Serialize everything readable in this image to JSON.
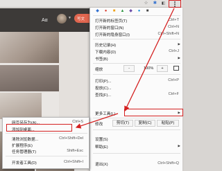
{
  "browser": {
    "avatar_text": "Aα",
    "publish_button": "写文",
    "toolbar_icons": [
      "star-icon",
      "extension-icon",
      "extension-icon",
      "menu-icon"
    ]
  },
  "main_menu": {
    "items": [
      {
        "label": "打开新的标签页(T)",
        "shortcut": "Ctrl+T"
      },
      {
        "label": "打开新的窗口(N)",
        "shortcut": "Ctrl+N"
      },
      {
        "label": "打开新的隐身窗口(I)",
        "shortcut": "Ctrl+Shift+N"
      },
      {
        "label": "历史记录(H)",
        "shortcut": ""
      },
      {
        "label": "下载内容(D)",
        "shortcut": "Ctrl+J"
      },
      {
        "label": "书签(B)",
        "shortcut": ""
      },
      {
        "label": "打印(P)...",
        "shortcut": "Ctrl+P"
      },
      {
        "label": "投放(C)...",
        "shortcut": ""
      },
      {
        "label": "查找(F)...",
        "shortcut": "Ctrl+F"
      },
      {
        "label": "更多工具(L)",
        "shortcut": ""
      },
      {
        "label": "设置(S)",
        "shortcut": ""
      },
      {
        "label": "帮助(E)",
        "shortcut": ""
      },
      {
        "label": "退出(X)",
        "shortcut": "Ctrl+Shift+Q"
      }
    ],
    "zoom": {
      "label": "缩放",
      "minus": "-",
      "value": "100%",
      "plus": "+"
    },
    "edit": {
      "label": "修改",
      "cut": "剪切(T)",
      "copy": "复制(C)",
      "paste": "粘贴(P)"
    },
    "accent_color": "#d42020"
  },
  "sub_menu": {
    "items": [
      {
        "label": "网页另存为(A)...",
        "shortcut": "Ctrl+S"
      },
      {
        "label": "添加到桌面...",
        "shortcut": ""
      },
      {
        "label": "清除浏览数据...",
        "shortcut": "Ctrl+Shift+Del"
      },
      {
        "label": "扩展程序(E)",
        "shortcut": ""
      },
      {
        "label": "任务管理器(T)",
        "shortcut": "Shift+Esc"
      },
      {
        "label": "开发者工具(D)",
        "shortcut": "Ctrl+Shift+I"
      }
    ]
  }
}
